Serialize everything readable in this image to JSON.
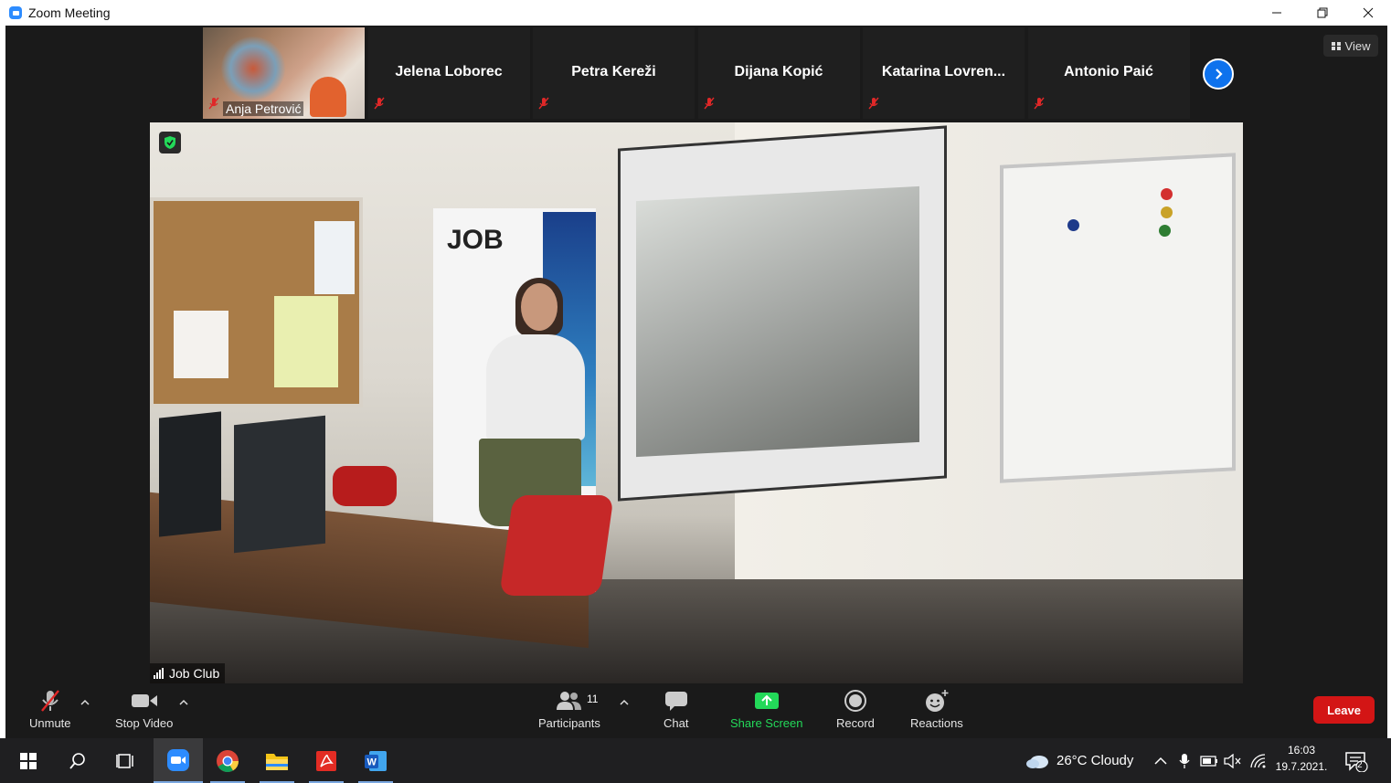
{
  "window": {
    "title": "Zoom Meeting"
  },
  "participants_strip": [
    {
      "name": "Anja Petrović",
      "has_video": true,
      "muted": true
    },
    {
      "name": "Jelena Loborec",
      "has_video": false,
      "muted": true
    },
    {
      "name": "Petra Kereži",
      "has_video": false,
      "muted": true
    },
    {
      "name": "Dijana Kopić",
      "has_video": false,
      "muted": true
    },
    {
      "name": "Katarina  Lovren...",
      "has_video": false,
      "muted": true
    },
    {
      "name": "Antonio Paić",
      "has_video": false,
      "muted": true
    }
  ],
  "view_button": {
    "label": "View"
  },
  "main_video": {
    "name": "Job Club",
    "banner_text": "JOB"
  },
  "toolbar": {
    "unmute": "Unmute",
    "stop_video": "Stop Video",
    "participants": "Participants",
    "participants_count": "11",
    "chat": "Chat",
    "share_screen": "Share Screen",
    "record": "Record",
    "reactions": "Reactions",
    "leave": "Leave"
  },
  "taskbar": {
    "weather": "26°C  Cloudy",
    "time": "16:03",
    "date": "19.7.2021.",
    "notifications": "2"
  },
  "colors": {
    "zoom_blue": "#0e72ed",
    "share_green": "#23d959",
    "leave_red": "#d31515",
    "mute_red": "#e02828"
  }
}
